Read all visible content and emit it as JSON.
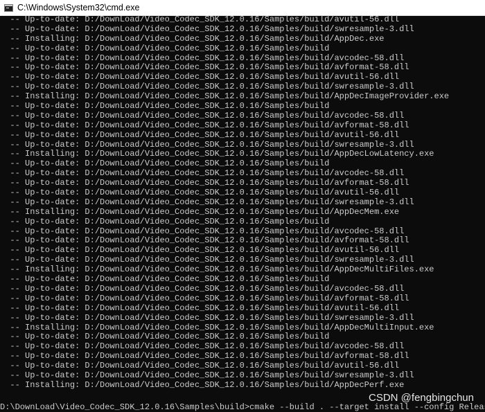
{
  "window": {
    "title": "C:\\Windows\\System32\\cmd.exe",
    "icon": "cmd-icon"
  },
  "console": {
    "lines": [
      "  -- Up-to-date: D:/DownLoad/Video_Codec_SDK_12.0.16/Samples/build/avutil-56.dll",
      "  -- Up-to-date: D:/DownLoad/Video_Codec_SDK_12.0.16/Samples/build/swresample-3.dll",
      "  -- Installing: D:/DownLoad/Video_Codec_SDK_12.0.16/Samples/build/AppDec.exe",
      "  -- Up-to-date: D:/DownLoad/Video_Codec_SDK_12.0.16/Samples/build",
      "  -- Up-to-date: D:/DownLoad/Video_Codec_SDK_12.0.16/Samples/build/avcodec-58.dll",
      "  -- Up-to-date: D:/DownLoad/Video_Codec_SDK_12.0.16/Samples/build/avformat-58.dll",
      "  -- Up-to-date: D:/DownLoad/Video_Codec_SDK_12.0.16/Samples/build/avutil-56.dll",
      "  -- Up-to-date: D:/DownLoad/Video_Codec_SDK_12.0.16/Samples/build/swresample-3.dll",
      "  -- Installing: D:/DownLoad/Video_Codec_SDK_12.0.16/Samples/build/AppDecImageProvider.exe",
      "  -- Up-to-date: D:/DownLoad/Video_Codec_SDK_12.0.16/Samples/build",
      "  -- Up-to-date: D:/DownLoad/Video_Codec_SDK_12.0.16/Samples/build/avcodec-58.dll",
      "  -- Up-to-date: D:/DownLoad/Video_Codec_SDK_12.0.16/Samples/build/avformat-58.dll",
      "  -- Up-to-date: D:/DownLoad/Video_Codec_SDK_12.0.16/Samples/build/avutil-56.dll",
      "  -- Up-to-date: D:/DownLoad/Video_Codec_SDK_12.0.16/Samples/build/swresample-3.dll",
      "  -- Installing: D:/DownLoad/Video_Codec_SDK_12.0.16/Samples/build/AppDecLowLatency.exe",
      "  -- Up-to-date: D:/DownLoad/Video_Codec_SDK_12.0.16/Samples/build",
      "  -- Up-to-date: D:/DownLoad/Video_Codec_SDK_12.0.16/Samples/build/avcodec-58.dll",
      "  -- Up-to-date: D:/DownLoad/Video_Codec_SDK_12.0.16/Samples/build/avformat-58.dll",
      "  -- Up-to-date: D:/DownLoad/Video_Codec_SDK_12.0.16/Samples/build/avutil-56.dll",
      "  -- Up-to-date: D:/DownLoad/Video_Codec_SDK_12.0.16/Samples/build/swresample-3.dll",
      "  -- Installing: D:/DownLoad/Video_Codec_SDK_12.0.16/Samples/build/AppDecMem.exe",
      "  -- Up-to-date: D:/DownLoad/Video_Codec_SDK_12.0.16/Samples/build",
      "  -- Up-to-date: D:/DownLoad/Video_Codec_SDK_12.0.16/Samples/build/avcodec-58.dll",
      "  -- Up-to-date: D:/DownLoad/Video_Codec_SDK_12.0.16/Samples/build/avformat-58.dll",
      "  -- Up-to-date: D:/DownLoad/Video_Codec_SDK_12.0.16/Samples/build/avutil-56.dll",
      "  -- Up-to-date: D:/DownLoad/Video_Codec_SDK_12.0.16/Samples/build/swresample-3.dll",
      "  -- Installing: D:/DownLoad/Video_Codec_SDK_12.0.16/Samples/build/AppDecMultiFiles.exe",
      "  -- Up-to-date: D:/DownLoad/Video_Codec_SDK_12.0.16/Samples/build",
      "  -- Up-to-date: D:/DownLoad/Video_Codec_SDK_12.0.16/Samples/build/avcodec-58.dll",
      "  -- Up-to-date: D:/DownLoad/Video_Codec_SDK_12.0.16/Samples/build/avformat-58.dll",
      "  -- Up-to-date: D:/DownLoad/Video_Codec_SDK_12.0.16/Samples/build/avutil-56.dll",
      "  -- Up-to-date: D:/DownLoad/Video_Codec_SDK_12.0.16/Samples/build/swresample-3.dll",
      "  -- Installing: D:/DownLoad/Video_Codec_SDK_12.0.16/Samples/build/AppDecMultiInput.exe",
      "  -- Up-to-date: D:/DownLoad/Video_Codec_SDK_12.0.16/Samples/build",
      "  -- Up-to-date: D:/DownLoad/Video_Codec_SDK_12.0.16/Samples/build/avcodec-58.dll",
      "  -- Up-to-date: D:/DownLoad/Video_Codec_SDK_12.0.16/Samples/build/avformat-58.dll",
      "  -- Up-to-date: D:/DownLoad/Video_Codec_SDK_12.0.16/Samples/build/avutil-56.dll",
      "  -- Up-to-date: D:/DownLoad/Video_Codec_SDK_12.0.16/Samples/build/swresample-3.dll",
      "  -- Installing: D:/DownLoad/Video_Codec_SDK_12.0.16/Samples/build/AppDecPerf.exe"
    ],
    "prompt": "D:\\DownLoad\\Video_Codec_SDK_12.0.16\\Samples\\build>cmake --build . --target install --config Release"
  },
  "watermark": "CSDN @fengbingchun"
}
